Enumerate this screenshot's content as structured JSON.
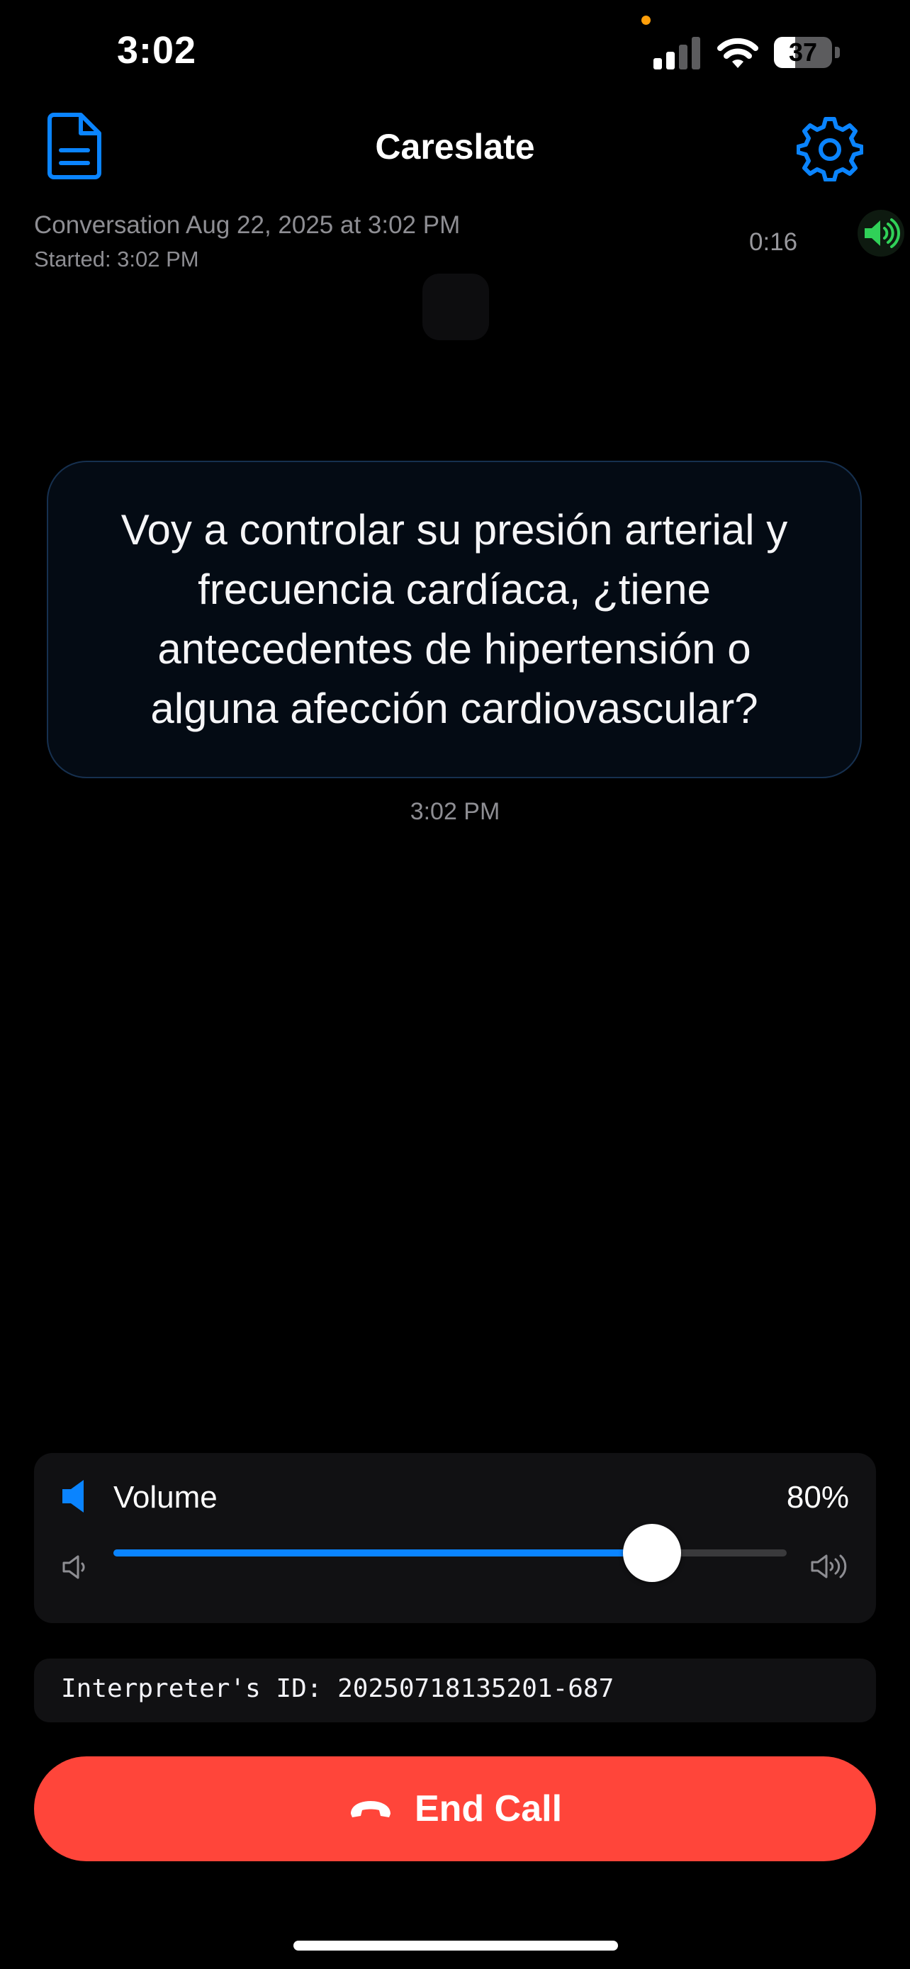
{
  "status_bar": {
    "time": "3:02",
    "battery_percent": "37",
    "battery_level": 0.37
  },
  "header": {
    "title": "Careslate",
    "document_icon": "document-icon",
    "settings_icon": "gear-icon"
  },
  "conversation": {
    "title": "Conversation Aug 22, 2025 at 3:02 PM",
    "started": "Started: 3:02 PM",
    "duration": "0:16",
    "speaker_icon": "speaker-active-icon"
  },
  "message": {
    "text": "Voy a controlar su presión arterial y frecuencia cardíaca, ¿tiene antecedentes de hipertensión o alguna afección cardiovascular?",
    "time": "3:02 PM"
  },
  "volume": {
    "label": "Volume",
    "value_text": "80%",
    "level": 0.8
  },
  "interpreter": {
    "id_text": "Interpreter's ID: 20250718135201-687"
  },
  "end_call": {
    "label": "End Call",
    "icon": "phone-hangup-icon"
  },
  "colors": {
    "accent": "#0a84ff",
    "danger": "#ff453a",
    "active_speaker": "#30d158"
  }
}
